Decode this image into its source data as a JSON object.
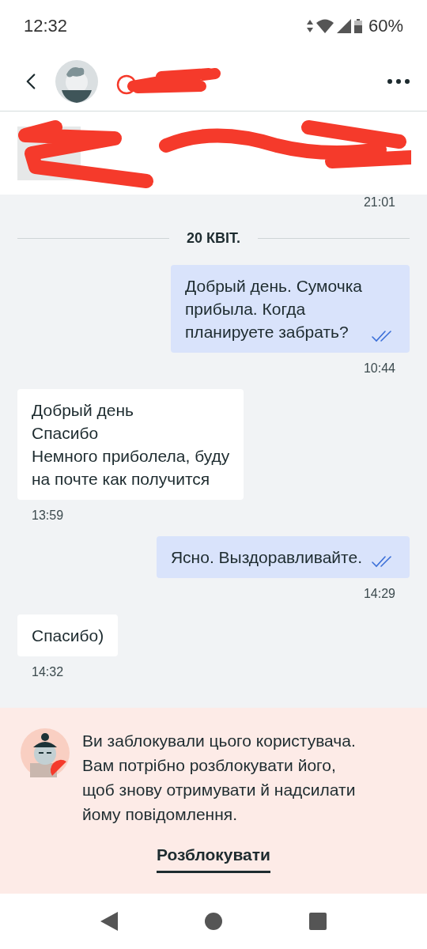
{
  "status_bar": {
    "time": "12:32",
    "battery": "60%"
  },
  "header": {
    "blocked": true
  },
  "previous_time": "21:01",
  "date_divider": "20 КВІТ.",
  "messages": [
    {
      "kind": "out",
      "text": "Добрый день. Сумочка\nприбыла. Когда\nпланируете забрать?",
      "time": "10:44",
      "read": true
    },
    {
      "kind": "in",
      "text": "Добрый день\nСпасибо\nНемного приболела, буду\nна почте как получится",
      "time": "13:59"
    },
    {
      "kind": "out",
      "text": "Ясно. Выздоравливайте.",
      "time": "14:29",
      "read": true
    },
    {
      "kind": "in",
      "text": "Спасибо)",
      "time": "14:32"
    }
  ],
  "blocked_notice": {
    "text": "Ви заблокували цього користувача. Вам потрібно розблокувати його, щоб знову отримувати й надсилати йому повідомлення.",
    "action": "Розблокувати"
  }
}
